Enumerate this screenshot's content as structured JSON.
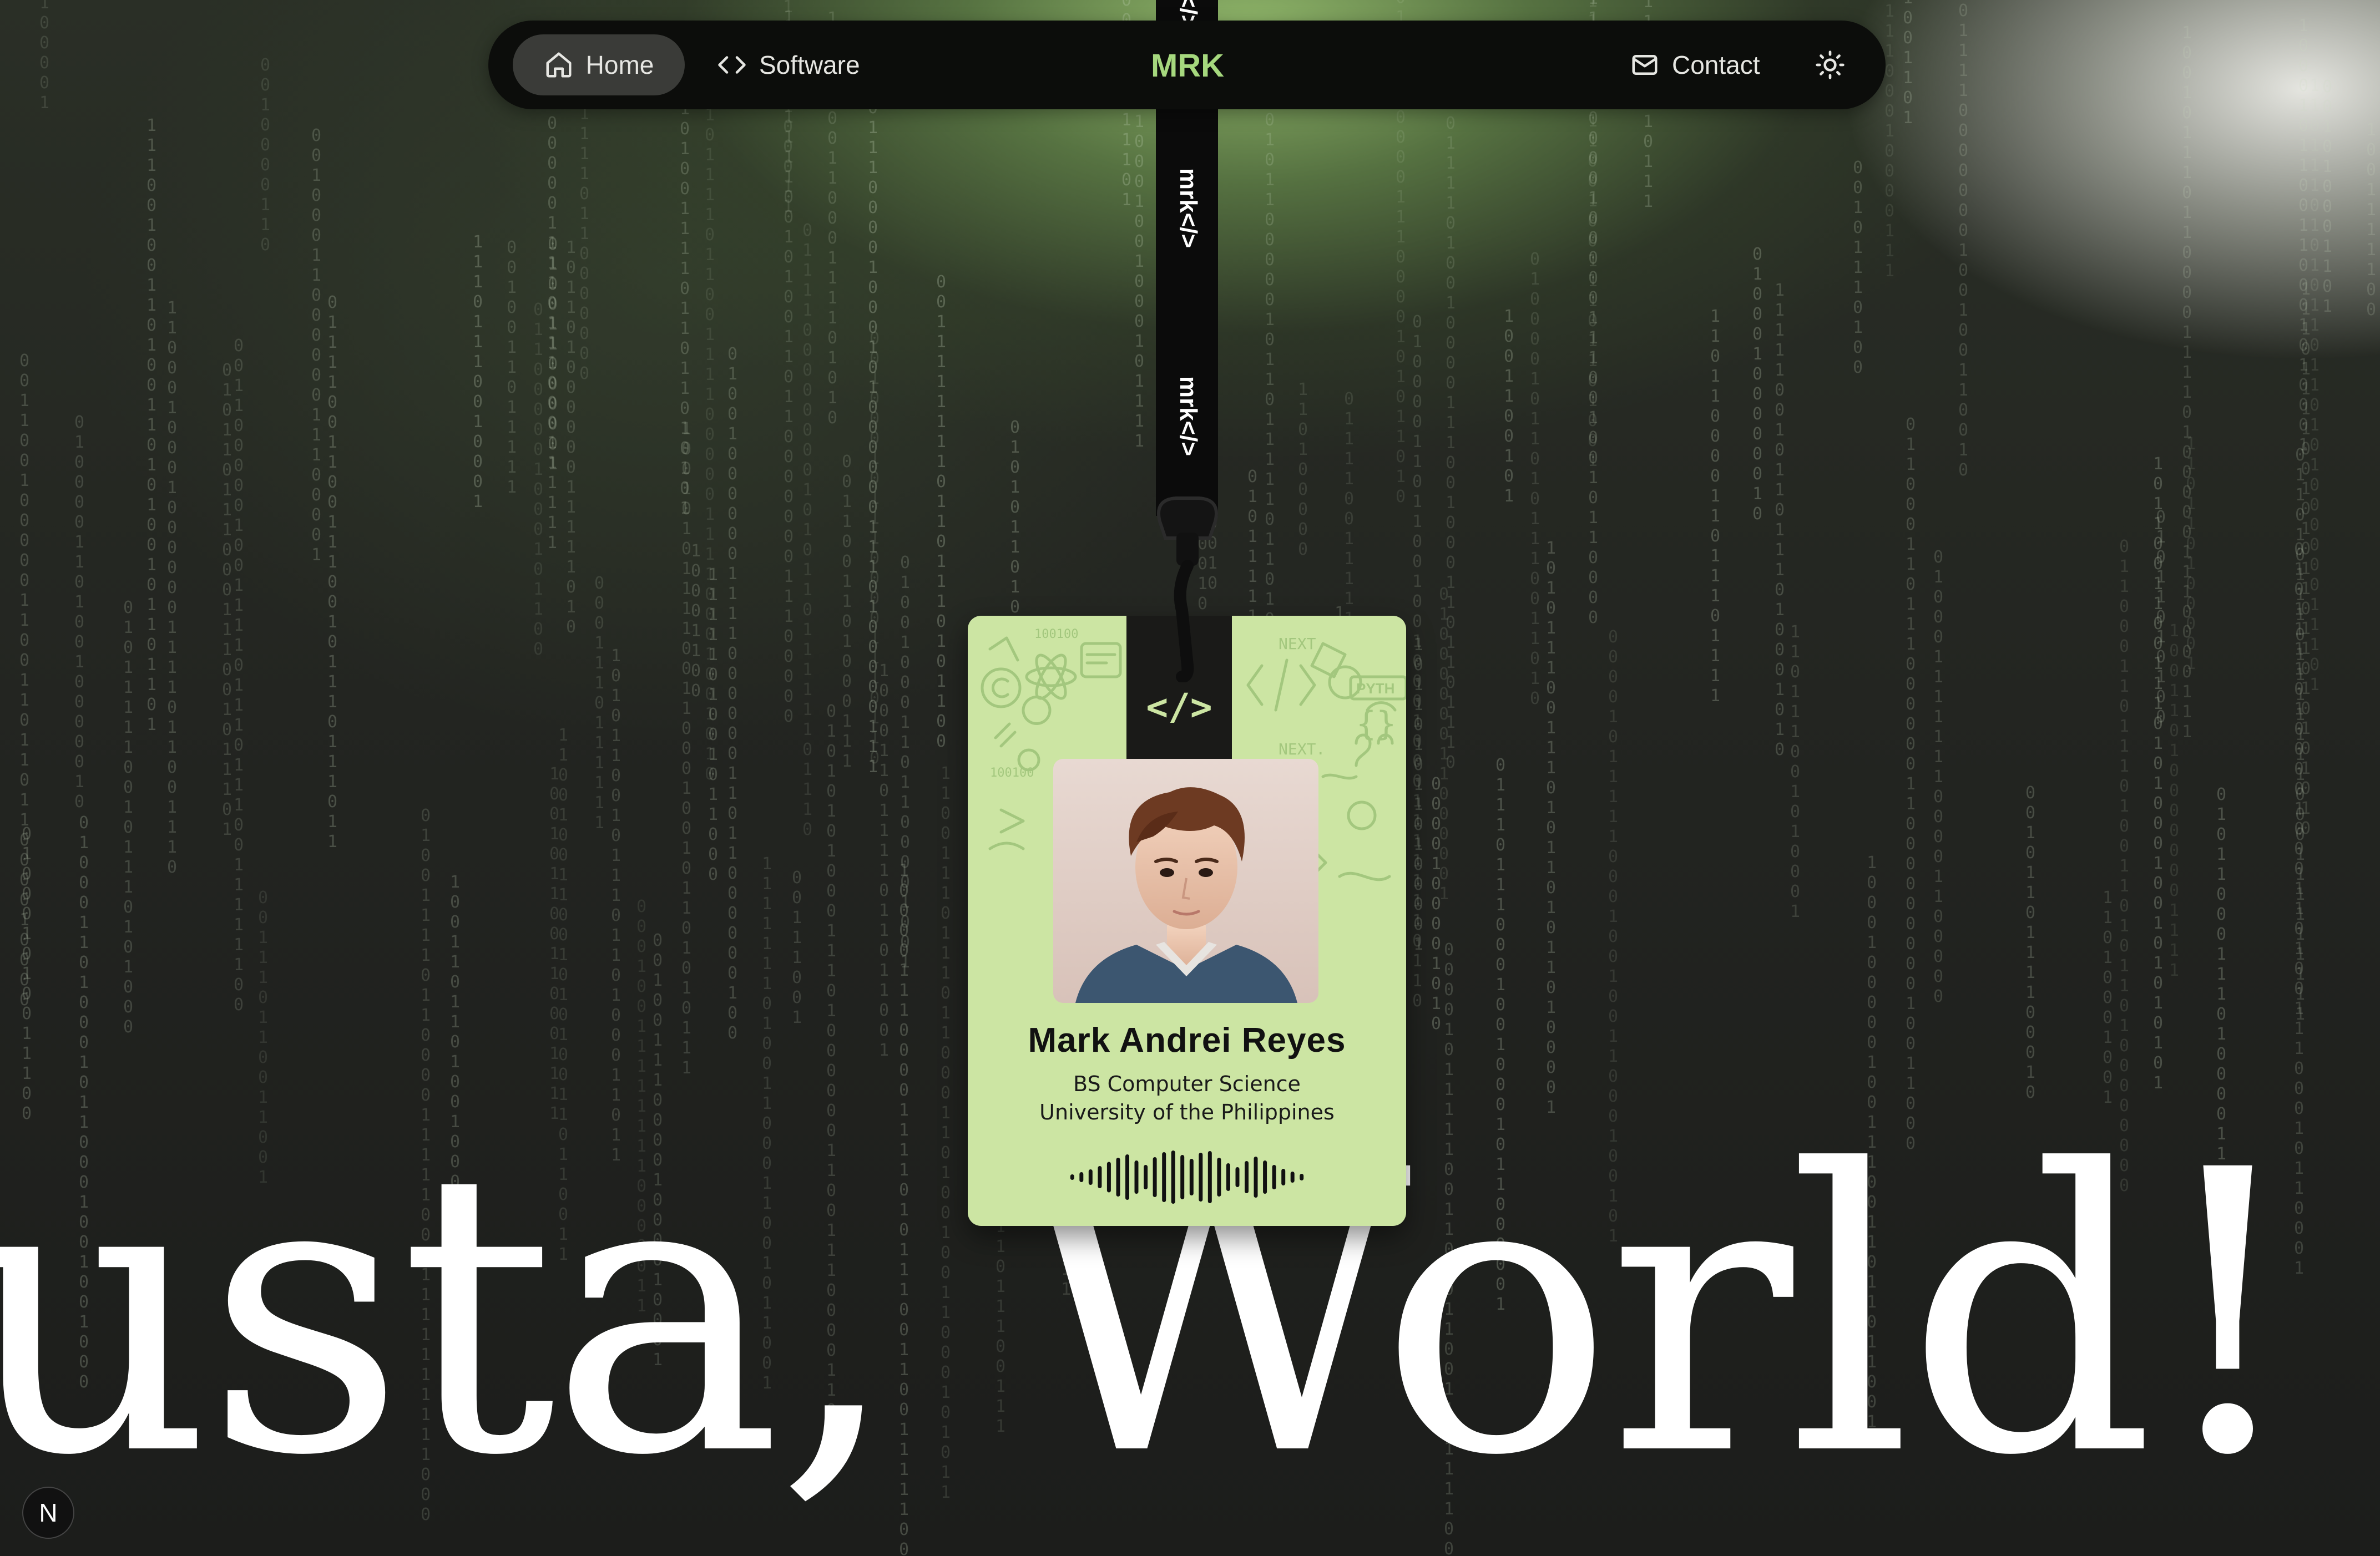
{
  "nav": {
    "home_label": "Home",
    "software_label": "Software",
    "logo_text": "MRK",
    "contact_label": "Contact",
    "theme_icon": "sun-icon"
  },
  "lanyard": {
    "strap_brand": "mrk</>"
  },
  "badge": {
    "slot_mark": "</>",
    "name": "Mark Andrei Reyes",
    "degree": "BS Computer Science",
    "school": "University of the Philippines"
  },
  "hero": {
    "greeting": "usta, World! I'm"
  },
  "dev_badge": {
    "letter": "N"
  },
  "colors": {
    "accent": "#a6d87e",
    "badge_bg": "#cce5a3",
    "nav_bg": "#0c0d0b"
  }
}
